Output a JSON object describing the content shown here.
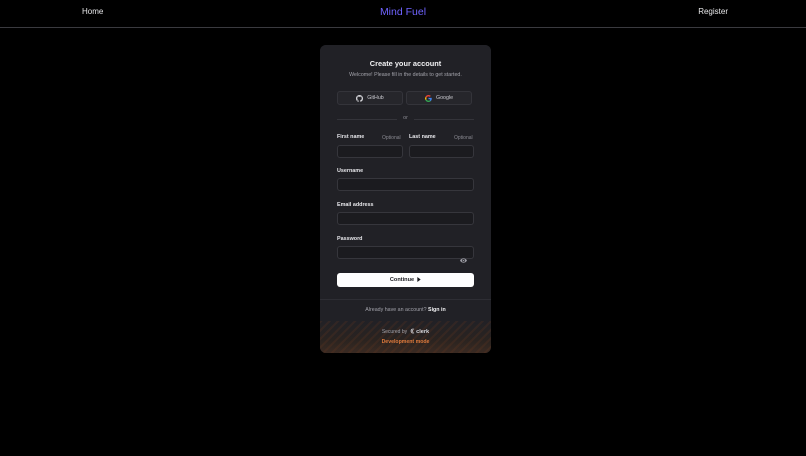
{
  "nav": {
    "home_label": "Home",
    "brand": "Mind Fuel",
    "register_label": "Register"
  },
  "colors": {
    "background": "#000000",
    "brand": "#6f63ff",
    "card": "#212126",
    "dev_mode": "#e07b3c"
  },
  "card": {
    "title": "Create your account",
    "subtitle": "Welcome! Please fill in the details to get started.",
    "social": [
      {
        "label": "GitHub",
        "icon": "github-icon"
      },
      {
        "label": "Google",
        "icon": "google-icon"
      }
    ],
    "divider_text": "or",
    "fields": {
      "first_name": {
        "label": "First name",
        "optional": "Optional",
        "value": ""
      },
      "last_name": {
        "label": "Last name",
        "optional": "Optional",
        "value": ""
      },
      "username": {
        "label": "Username",
        "value": ""
      },
      "email": {
        "label": "Email address",
        "value": ""
      },
      "password": {
        "label": "Password",
        "value": "",
        "toggle_icon": "eye-icon"
      }
    },
    "continue_label": "Continue",
    "continue_icon": "caret-right-icon",
    "footer": {
      "prompt": "Already have an account?",
      "signin_label": "Sign in"
    },
    "secured_by": "Secured by",
    "clerk_label": "clerk",
    "dev_mode": "Development mode"
  }
}
